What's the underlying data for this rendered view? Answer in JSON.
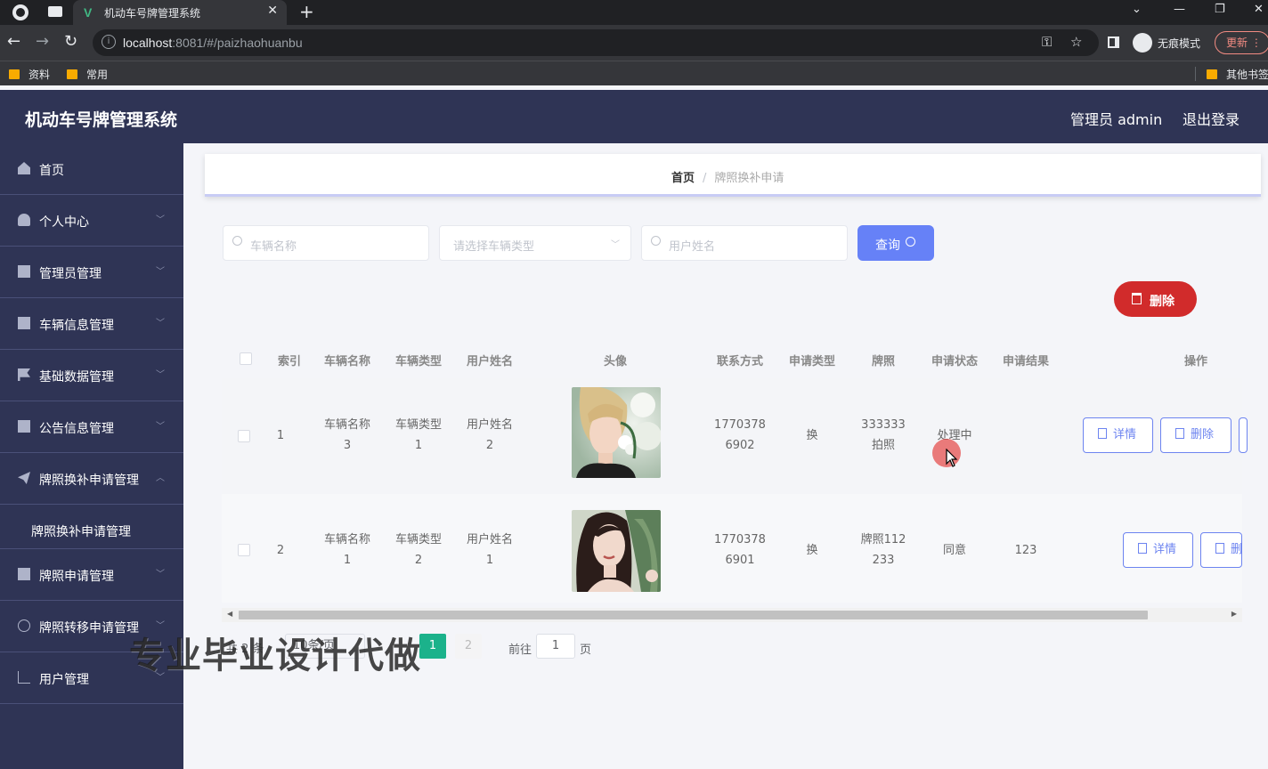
{
  "browser": {
    "tab_title": "机动车号牌管理系统",
    "url_host": "localhost",
    "url_rest": ":8081/#/paizhaohuanbu",
    "incognito_label": "无痕模式",
    "update_label": "更新",
    "bookmarks": [
      "资料",
      "常用",
      "其他书签"
    ]
  },
  "header": {
    "title": "机动车号牌管理系统",
    "user": "管理员 admin",
    "logout": "退出登录"
  },
  "sidebar": {
    "items": [
      {
        "label": "首页"
      },
      {
        "label": "个人中心"
      },
      {
        "label": "管理员管理"
      },
      {
        "label": "车辆信息管理"
      },
      {
        "label": "基础数据管理"
      },
      {
        "label": "公告信息管理"
      },
      {
        "label": "牌照换补申请管理",
        "expanded": true
      },
      {
        "label": "牌照换补申请管理"
      },
      {
        "label": "牌照申请管理"
      },
      {
        "label": "牌照转移申请管理"
      },
      {
        "label": "用户管理"
      }
    ]
  },
  "breadcrumb": {
    "home": "首页",
    "separator": "/",
    "current": "牌照换补申请"
  },
  "search": {
    "vehicle_name_placeholder": "车辆名称",
    "vehicle_type_placeholder": "请选择车辆类型",
    "user_name_placeholder": "用户姓名",
    "query_label": "查询"
  },
  "actions": {
    "delete_label": "删除"
  },
  "table": {
    "columns": [
      "索引",
      "车辆名称",
      "车辆类型",
      "用户姓名",
      "头像",
      "联系方式",
      "申请类型",
      "牌照",
      "申请状态",
      "申请结果",
      "操作"
    ],
    "rows": [
      {
        "index": "1",
        "vehicle_name": [
          "车辆名称",
          "3"
        ],
        "vehicle_type": [
          "车辆类型",
          "1"
        ],
        "user_name": [
          "用户姓名",
          "2"
        ],
        "contact": [
          "1770378",
          "6902"
        ],
        "apply_type": "换",
        "plate": [
          "333333",
          "拍照"
        ],
        "status": "处理中",
        "result": "",
        "detail_label": "详情",
        "delete_label": "删除"
      },
      {
        "index": "2",
        "vehicle_name": [
          "车辆名称",
          "1"
        ],
        "vehicle_type": [
          "车辆类型",
          "2"
        ],
        "user_name": [
          "用户姓名",
          "1"
        ],
        "contact": [
          "1770378",
          "6901"
        ],
        "apply_type": "换",
        "plate": [
          "牌照112",
          "233"
        ],
        "status": "同意",
        "result": "123",
        "detail_label": "详情",
        "delete_label": "删除"
      }
    ]
  },
  "pagination": {
    "total": "共 2 条",
    "page_size": "10条/页",
    "pages": [
      "1",
      "2"
    ],
    "current": "1",
    "goto_label": "前往",
    "goto_value": "1",
    "page_label": "页"
  },
  "watermark": "专业毕业设计代做"
}
